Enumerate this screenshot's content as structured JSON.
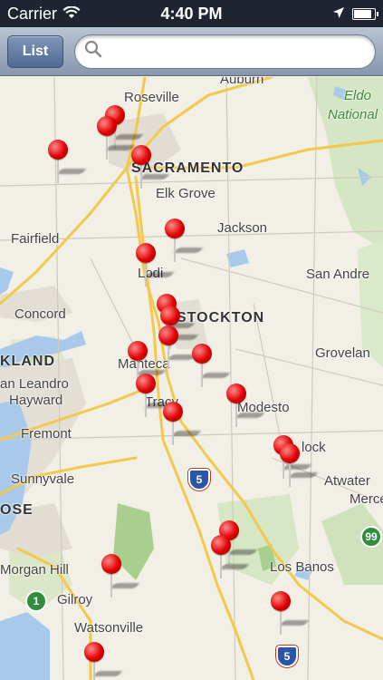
{
  "status_bar": {
    "carrier": "Carrier",
    "time": "4:40 PM",
    "battery_level": 0.9
  },
  "nav_bar": {
    "list_button_label": "List",
    "search_placeholder": "",
    "search_value": ""
  },
  "map": {
    "labels": {
      "roseville": "Roseville",
      "auburn": "Auburn",
      "eldo_national": "Eldo",
      "national": "National",
      "sacramento": "SACRAMENTO",
      "elk_grove": "Elk Grove",
      "jackson": "Jackson",
      "fairfield": "Fairfield",
      "lodi": "Lodi",
      "san_andreas": "San Andre",
      "concord": "Concord",
      "stockton": "STOCKTON",
      "groveland": "Grovelan",
      "oakland": "KLAND",
      "manteca": "Manteca",
      "san_leandro": "an Leandro",
      "hayward": "Hayward",
      "tracy": "Tracy",
      "modesto": "Modesto",
      "fremont": "Fremont",
      "turlock": "lock",
      "sunnyvale": "Sunnyvale",
      "atwater": "Atwater",
      "san_jose": "OSE",
      "merced": "Merce",
      "morgan_hill": "Morgan Hill",
      "los_banos": "Los Banos",
      "gilroy": "Gilroy",
      "watsonville": "Watsonville"
    },
    "shields": {
      "i5_north": "5",
      "i5_south": "5",
      "sr99": "99",
      "sr1": "1"
    }
  }
}
